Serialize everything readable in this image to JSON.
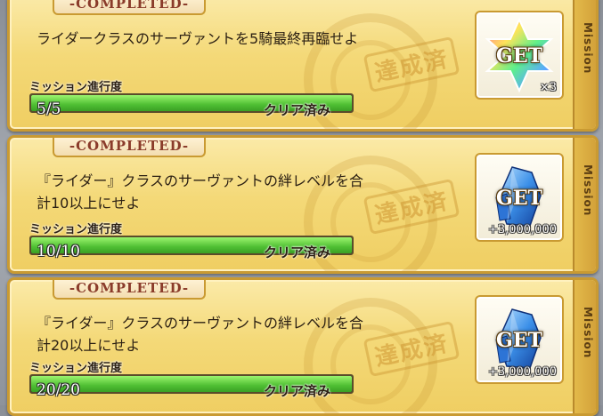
{
  "missions": [
    {
      "completed_tag": "-COMPLETED-",
      "description_lines": [
        "ライダークラスのサーヴァントを5騎最終再臨せよ",
        ""
      ],
      "progress_label": "ミッション進行度",
      "progress_value": "5/5",
      "progress_fraction": 1.0,
      "status": "クリア済み",
      "stamp": "達成済",
      "reward_label": "GET",
      "reward_quantity": "×3",
      "reward_icon": "saint-quartz-icon",
      "side_label": "Mission"
    },
    {
      "completed_tag": "-COMPLETED-",
      "description_lines": [
        "『ライダー』クラスのサーヴァントの絆レベルを合",
        "計10以上にせよ"
      ],
      "progress_label": "ミッション進行度",
      "progress_value": "10/10",
      "progress_fraction": 1.0,
      "status": "クリア済み",
      "stamp": "達成済",
      "reward_label": "GET",
      "reward_quantity": "+3,000,000",
      "reward_icon": "qp-crystal-icon",
      "side_label": "Mission"
    },
    {
      "completed_tag": "-COMPLETED-",
      "description_lines": [
        "『ライダー』クラスのサーヴァントの絆レベルを合",
        "計20以上にせよ"
      ],
      "progress_label": "ミッション進行度",
      "progress_value": "20/20",
      "progress_fraction": 1.0,
      "status": "クリア済み",
      "stamp": "達成済",
      "reward_label": "GET",
      "reward_quantity": "+3,000,000",
      "reward_icon": "qp-crystal-icon",
      "side_label": "Mission"
    }
  ]
}
